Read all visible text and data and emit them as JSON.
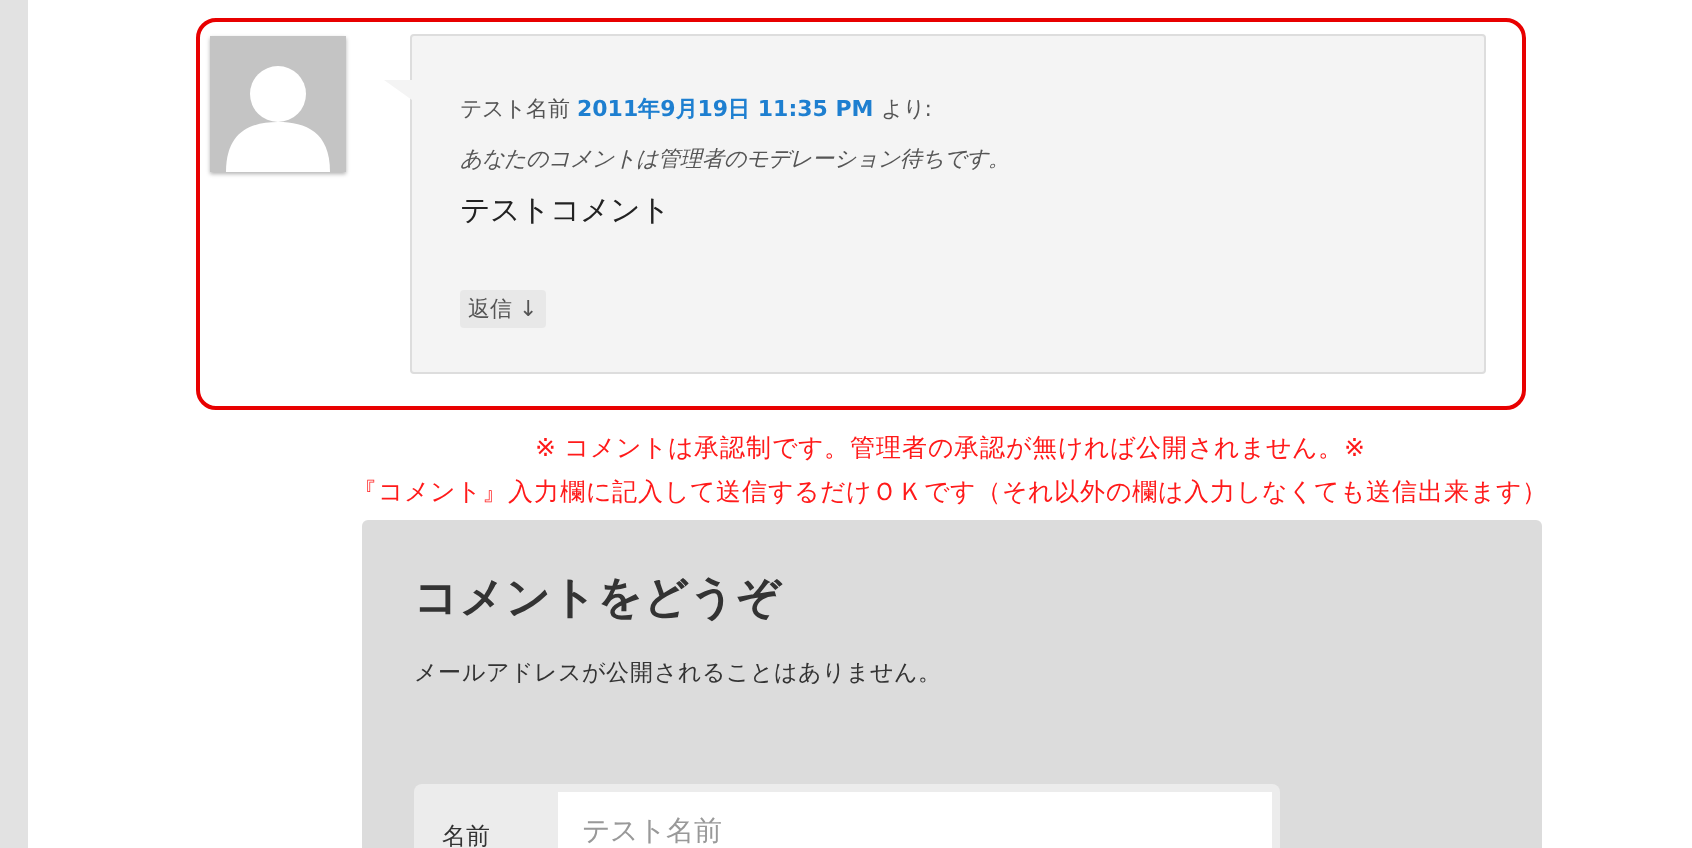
{
  "comment": {
    "author": "テスト名前",
    "date": "2011年9月19日 11:35 PM",
    "suffix": "より:",
    "moderation_note": "あなたのコメントは管理者のモデレーション待ちです。",
    "body": "テストコメント",
    "reply_button": "返信 ↓"
  },
  "notices": [
    "※ コメントは承認制です。管理者の承認が無ければ公開されません。※",
    "『コメント』入力欄に記入して送信するだけＯＫです（それ以外の欄は入力しなくても送信出来ます）"
  ],
  "form": {
    "title": "コメントをどうぞ",
    "note": "メールアドレスが公開されることはありません。",
    "fields": [
      {
        "label": "名前",
        "placeholder": "テスト名前"
      }
    ]
  }
}
